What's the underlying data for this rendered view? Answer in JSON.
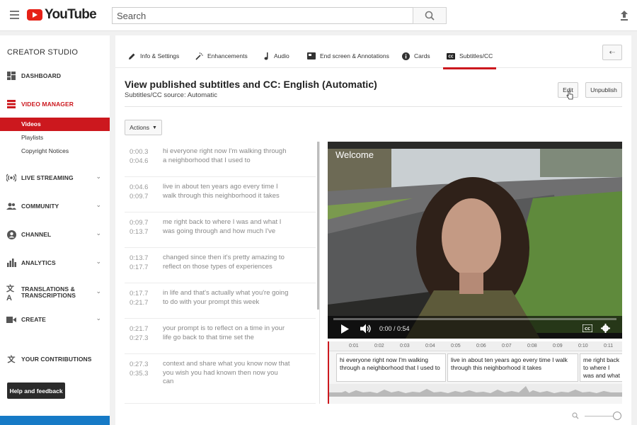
{
  "header": {
    "logo_text": "YouTube",
    "search_placeholder": "Search"
  },
  "sidebar": {
    "title": "CREATOR STUDIO",
    "items": [
      {
        "label": "DASHBOARD",
        "icon": "dashboard-icon",
        "expandable": false
      },
      {
        "label": "VIDEO MANAGER",
        "icon": "video-manager-icon",
        "expandable": false,
        "active": true
      },
      {
        "label": "LIVE STREAMING",
        "icon": "live-streaming-icon",
        "expandable": true
      },
      {
        "label": "COMMUNITY",
        "icon": "community-icon",
        "expandable": true
      },
      {
        "label": "CHANNEL",
        "icon": "channel-icon",
        "expandable": true
      },
      {
        "label": "ANALYTICS",
        "icon": "analytics-icon",
        "expandable": true
      },
      {
        "label": "TRANSLATIONS & TRANSCRIPTIONS",
        "icon": "translate-icon",
        "expandable": true
      },
      {
        "label": "CREATE",
        "icon": "create-icon",
        "expandable": true
      },
      {
        "label": "YOUR CONTRIBUTIONS",
        "icon": "contributions-icon",
        "expandable": false
      }
    ],
    "subitems": [
      {
        "label": "Videos",
        "selected": true
      },
      {
        "label": "Playlists",
        "selected": false
      },
      {
        "label": "Copyright Notices",
        "selected": false
      }
    ],
    "help_label": "Help and feedback"
  },
  "tabs": [
    {
      "label": "Info & Settings",
      "icon": "pencil-icon"
    },
    {
      "label": "Enhancements",
      "icon": "magic-wand-icon"
    },
    {
      "label": "Audio",
      "icon": "music-note-icon"
    },
    {
      "label": "End screen & Annotations",
      "icon": "end-screen-icon"
    },
    {
      "label": "Cards",
      "icon": "info-icon"
    },
    {
      "label": "Subtitles/CC",
      "icon": "cc-icon",
      "active": true
    }
  ],
  "page": {
    "title": "View published subtitles and CC: English (Automatic)",
    "subtitle": "Subtitles/CC source: Automatic",
    "edit_label": "Edit",
    "unpublish_label": "Unpublish",
    "actions_label": "Actions"
  },
  "captions": [
    {
      "start": "0:00.3",
      "end": "0:04.6",
      "text": "hi everyone right now I'm walking through a neighborhood that I used to"
    },
    {
      "start": "0:04.6",
      "end": "0:09.7",
      "text": "live in about ten years ago every time I walk through this neighborhood it takes"
    },
    {
      "start": "0:09.7",
      "end": "0:13.7",
      "text": "me right back to where I was and what I was going through and how much I've"
    },
    {
      "start": "0:13.7",
      "end": "0:17.7",
      "text": "changed since then it's pretty amazing to reflect on those types of experiences"
    },
    {
      "start": "0:17.7",
      "end": "0:21.7",
      "text": "in life and that's actually what you're going to do with your prompt this week"
    },
    {
      "start": "0:21.7",
      "end": "0:27.3",
      "text": "your prompt is to reflect on a time in your life go back to that time set the"
    },
    {
      "start": "0:27.3",
      "end": "0:35.3",
      "text": "context and share what you know now that you wish you had known then now you can"
    }
  ],
  "video": {
    "overlay_title": "Welcome",
    "time_current": "0:00",
    "time_total": "0:54",
    "progress": 0.0
  },
  "timeline": {
    "ticks": [
      "0:01",
      "0:02",
      "0:03",
      "0:04",
      "0:05",
      "0:06",
      "0:07",
      "0:08",
      "0:09",
      "0:10",
      "0:11"
    ],
    "cues": [
      "hi everyone right now I'm walking through a neighborhood that I used to",
      "live in about ten years ago every time I walk through this neighborhood it takes",
      "me right back to where I was and what I was going thr"
    ]
  },
  "colors": {
    "accent_red": "#cc181e",
    "sidebar_bottom_blue": "#167ac6"
  }
}
